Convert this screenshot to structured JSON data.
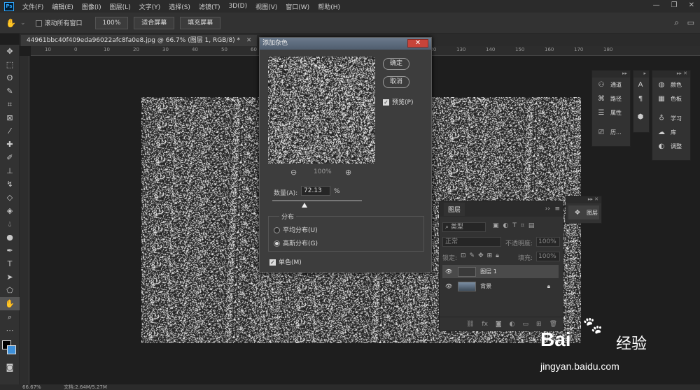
{
  "menubar": {
    "logo": "Ps",
    "items": [
      "文件(F)",
      "编辑(E)",
      "图像(I)",
      "图层(L)",
      "文字(Y)",
      "选择(S)",
      "滤镜(T)",
      "3D(D)",
      "视图(V)",
      "窗口(W)",
      "帮助(H)"
    ]
  },
  "options": {
    "scroll_all": "滚动所有窗口",
    "zoom": "100%",
    "fit_screen": "适合屏幕",
    "fill_screen": "填充屏幕"
  },
  "document": {
    "tab_title": "44961bbc40f409eda96022afc8fa0e8.jpg @ 66.7% (图层 1, RGB/8) *",
    "ruler_ticks": [
      "10",
      "0",
      "10",
      "20",
      "30",
      "40",
      "50",
      "60",
      "70",
      "80",
      "90",
      "100",
      "110",
      "120",
      "130",
      "140",
      "150",
      "160",
      "170",
      "180"
    ]
  },
  "dialog": {
    "title": "添加杂色",
    "ok": "确定",
    "cancel": "取消",
    "preview_label": "预览(P)",
    "preview_checked": true,
    "zoom_value": "100%",
    "amount_label": "数量(A):",
    "amount_value": "72.13",
    "amount_unit": "%",
    "amount_level": 0.36,
    "distribution_label": "分布",
    "uniform": "平均分布(U)",
    "gaussian": "高斯分布(G)",
    "gaussian_selected": true,
    "mono_label": "单色(M)",
    "mono_checked": true
  },
  "right_panels": {
    "col1": [
      "通道",
      "路径",
      "属性",
      "历..."
    ],
    "col3": [
      "颜色",
      "色板",
      "学习",
      "库",
      "调整"
    ]
  },
  "layers_panel": {
    "title": "图层",
    "kind": "类型",
    "blend": "正常",
    "opacity_label": "不透明度:",
    "opacity_value": "100%",
    "lock_label": "锁定:",
    "fill_label": "填充:",
    "fill_value": "100%",
    "layers": [
      {
        "name": "图层 1",
        "selected": true
      },
      {
        "name": "背景",
        "selected": false
      }
    ],
    "floating_tab": "图层"
  },
  "status": {
    "zoom": "66.67%",
    "doc": "文档:2.64M/5.27M"
  },
  "watermark": {
    "brand": "Bai",
    "brand2": "经验",
    "url": "jingyan.baidu.com"
  }
}
